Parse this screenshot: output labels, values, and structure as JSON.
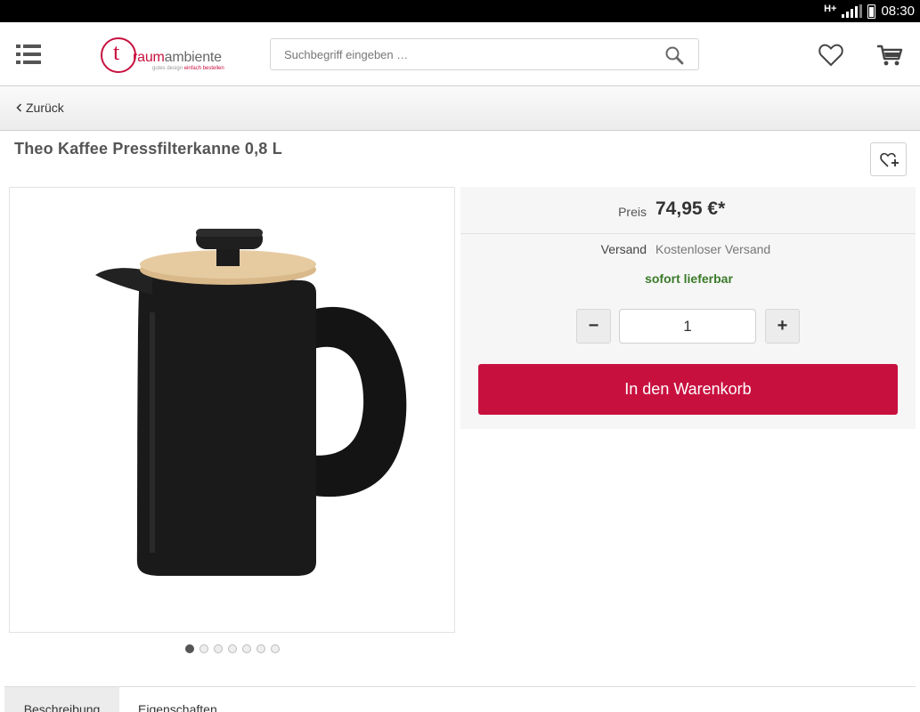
{
  "status_bar": {
    "network": "H+",
    "time": "08:30"
  },
  "header": {
    "logo": {
      "letter": "t",
      "word_brand": "raum",
      "word_rest": "ambiente",
      "tagline_gray": "gutes design ",
      "tagline_red": "einfach bestellen"
    },
    "search": {
      "placeholder": "Suchbegriff eingeben …"
    },
    "icons": {
      "menu": "menu-icon",
      "search": "search-icon",
      "wishlist": "heart-icon",
      "cart": "cart-icon"
    }
  },
  "back_bar": {
    "label": "Zurück"
  },
  "product": {
    "title": "Theo Kaffee Pressfilterkanne 0,8 L",
    "gallery": {
      "count": 7,
      "active_index": 0
    },
    "price_label": "Preis",
    "price": "74,95 €*",
    "shipping_label": "Versand",
    "shipping_value": "Kostenloser Versand",
    "availability": "sofort lieferbar",
    "quantity": "1",
    "minus_label": "−",
    "plus_label": "+",
    "add_to_cart": "In den Warenkorb"
  },
  "tabs": [
    {
      "label": "Beschreibung",
      "active": true
    },
    {
      "label": "Eigenschaften",
      "active": false
    }
  ],
  "colors": {
    "accent": "#c8103f",
    "stock_green": "#3b7a2a"
  }
}
